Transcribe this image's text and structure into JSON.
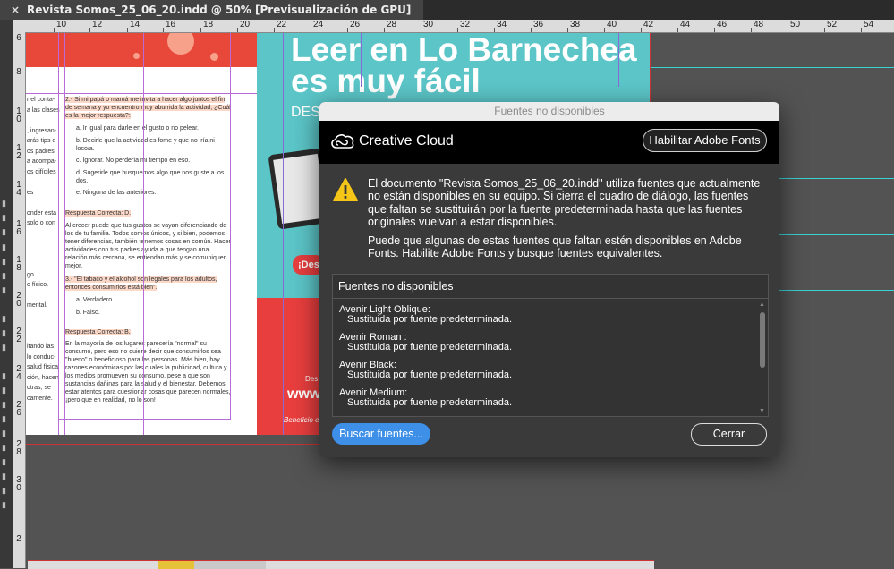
{
  "window": {
    "tab_title": "Revista Somos_25_06_20.indd @ 50% [Previsualización de GPU]",
    "close_glyph": "×"
  },
  "ruler_top": [
    "10",
    "12",
    "14",
    "16",
    "18",
    "20",
    "22",
    "24",
    "26",
    "28",
    "30",
    "32",
    "34",
    "36",
    "38",
    "40",
    "42",
    "44",
    "46",
    "48",
    "50",
    "52",
    "54"
  ],
  "ruler_left": [
    "6",
    "8",
    "1\n0",
    "1\n2",
    "1\n4",
    "1\n6",
    "1\n8",
    "2\n0",
    "2\n2",
    "2\n4",
    "2\n6",
    "2\n8",
    "3\n0",
    "2"
  ],
  "page_left": {
    "q2": "2.- Si mi papá o mamá me invita a hacer algo juntos el fin de semana y yo encuentro muy aburrida la actividad, ¿Cuál es la mejor respuesta?:",
    "q2_a": "a.  Ir igual para darle en el gusto o no pelear.",
    "q2_b": "b.  Decirle que la actividad es fome y que no iría ni loco/a.",
    "q2_c": "c.  Ignorar. No perdería mi tiempo en eso.",
    "q2_d": "d.  Sugerirle que busquemos algo que nos guste a los dos.",
    "q2_e": "e.  Ninguna de las anteriores.",
    "ans2": "Respuesta Correcta: D.",
    "exp2": "Al crecer puede que tus gustos se vayan diferenciando de los de tu familia. Todos somos únicos, y si bien, podemos tener diferencias, también tenemos cosas en común. Hacer actividades con tus padres ayuda a que tengan una relación más cercana, se entiendan más y se comuniquen mejor.",
    "q3": "3.- \"El tabaco y el alcohol son legales para los adultos, entonces consumirlos está bien\".",
    "q3_a": "a.  Verdadero.",
    "q3_b": "b.  Falso.",
    "ans3": "Respuesta Correcta: B.",
    "exp3": "En la mayoría de los lugares parecería \"normal\" su consumo, pero eso no quiere decir que consumirlos sea \"bueno\" o beneficioso para las personas. Más bien, hay razones económicas por las cuales la publicidad, cultura y los medios promueven su consumo, pese a que son sustancias dañinas para la salud y el bienestar. Debemos estar atentos para cuestionar cosas que parecen normales, ¡pero que en realidad, no lo son!",
    "edge_lines": [
      "r el conta-",
      "a las clases",
      "",
      ", ingresan-",
      "arás tips e",
      "os padres",
      "a acompa-",
      "os difíciles",
      "",
      "es",
      "",
      "onder esta",
      "solo o con",
      "",
      "",
      "",
      "",
      "go.",
      "o físico.",
      "",
      "mental.",
      "",
      "",
      "",
      "itando las",
      "lo conduc-",
      "salud física",
      "ción, hacen",
      "otras, se",
      "camente."
    ]
  },
  "page_right": {
    "headline_1": "Leer en Lo Barnechea",
    "headline_2": "es muy fácil",
    "des": "DES",
    "pill": "¡Des",
    "des2": "Des",
    "www": "www",
    "bene": "Beneficio e"
  },
  "dialog": {
    "title": "Fuentes no disponibles",
    "brand": "Creative Cloud",
    "enable_button": "Habilitar Adobe Fonts",
    "message_1": "El documento \"Revista Somos_25_06_20.indd\" utiliza fuentes que actualmente no están disponibles en su equipo. Si cierra el cuadro de diálogo, las fuentes que faltan se sustituirán por la fuente predeterminada hasta que las fuentes originales vuelvan a estar disponibles.",
    "message_2": "Puede que algunas de estas fuentes que faltan estén disponibles en Adobe Fonts. Habilite Adobe Fonts y busque fuentes equivalentes.",
    "list_header": "Fuentes no disponibles",
    "fonts": [
      {
        "name": "Avenir Light Oblique:",
        "status": "Sustituida por fuente predeterminada."
      },
      {
        "name": "Avenir Roman :",
        "status": "Sustituida por fuente predeterminada."
      },
      {
        "name": "Avenir Black:",
        "status": "Sustituida por fuente predeterminada."
      },
      {
        "name": "Avenir Medium:",
        "status": "Sustituida por fuente predeterminada."
      }
    ],
    "find_button": "Buscar fuentes...",
    "close_button": "Cerrar",
    "colors": {
      "primary_button": "#3d8fe8",
      "warning": "#f5c518",
      "title_bar": "#ececec"
    }
  }
}
